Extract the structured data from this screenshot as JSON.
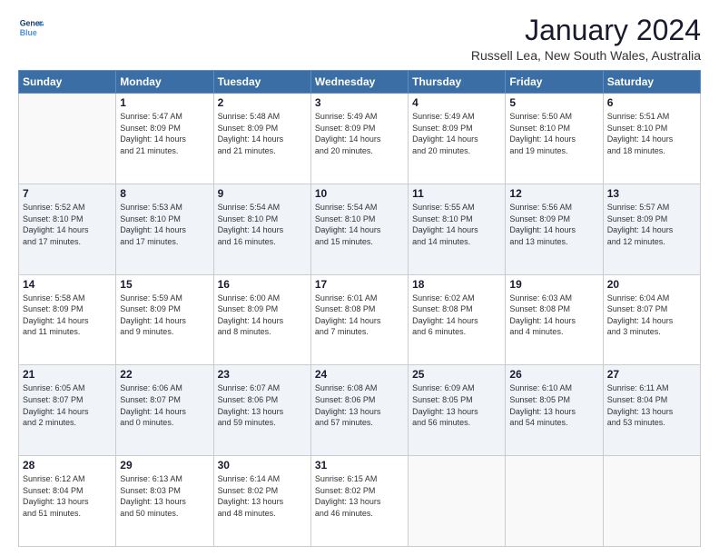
{
  "logo": {
    "line1": "General",
    "line2": "Blue"
  },
  "title": "January 2024",
  "subtitle": "Russell Lea, New South Wales, Australia",
  "weekdays": [
    "Sunday",
    "Monday",
    "Tuesday",
    "Wednesday",
    "Thursday",
    "Friday",
    "Saturday"
  ],
  "weeks": [
    [
      {
        "day": "",
        "info": ""
      },
      {
        "day": "1",
        "info": "Sunrise: 5:47 AM\nSunset: 8:09 PM\nDaylight: 14 hours\nand 21 minutes."
      },
      {
        "day": "2",
        "info": "Sunrise: 5:48 AM\nSunset: 8:09 PM\nDaylight: 14 hours\nand 21 minutes."
      },
      {
        "day": "3",
        "info": "Sunrise: 5:49 AM\nSunset: 8:09 PM\nDaylight: 14 hours\nand 20 minutes."
      },
      {
        "day": "4",
        "info": "Sunrise: 5:49 AM\nSunset: 8:09 PM\nDaylight: 14 hours\nand 20 minutes."
      },
      {
        "day": "5",
        "info": "Sunrise: 5:50 AM\nSunset: 8:10 PM\nDaylight: 14 hours\nand 19 minutes."
      },
      {
        "day": "6",
        "info": "Sunrise: 5:51 AM\nSunset: 8:10 PM\nDaylight: 14 hours\nand 18 minutes."
      }
    ],
    [
      {
        "day": "7",
        "info": "Sunrise: 5:52 AM\nSunset: 8:10 PM\nDaylight: 14 hours\nand 17 minutes."
      },
      {
        "day": "8",
        "info": "Sunrise: 5:53 AM\nSunset: 8:10 PM\nDaylight: 14 hours\nand 17 minutes."
      },
      {
        "day": "9",
        "info": "Sunrise: 5:54 AM\nSunset: 8:10 PM\nDaylight: 14 hours\nand 16 minutes."
      },
      {
        "day": "10",
        "info": "Sunrise: 5:54 AM\nSunset: 8:10 PM\nDaylight: 14 hours\nand 15 minutes."
      },
      {
        "day": "11",
        "info": "Sunrise: 5:55 AM\nSunset: 8:10 PM\nDaylight: 14 hours\nand 14 minutes."
      },
      {
        "day": "12",
        "info": "Sunrise: 5:56 AM\nSunset: 8:09 PM\nDaylight: 14 hours\nand 13 minutes."
      },
      {
        "day": "13",
        "info": "Sunrise: 5:57 AM\nSunset: 8:09 PM\nDaylight: 14 hours\nand 12 minutes."
      }
    ],
    [
      {
        "day": "14",
        "info": "Sunrise: 5:58 AM\nSunset: 8:09 PM\nDaylight: 14 hours\nand 11 minutes."
      },
      {
        "day": "15",
        "info": "Sunrise: 5:59 AM\nSunset: 8:09 PM\nDaylight: 14 hours\nand 9 minutes."
      },
      {
        "day": "16",
        "info": "Sunrise: 6:00 AM\nSunset: 8:09 PM\nDaylight: 14 hours\nand 8 minutes."
      },
      {
        "day": "17",
        "info": "Sunrise: 6:01 AM\nSunset: 8:08 PM\nDaylight: 14 hours\nand 7 minutes."
      },
      {
        "day": "18",
        "info": "Sunrise: 6:02 AM\nSunset: 8:08 PM\nDaylight: 14 hours\nand 6 minutes."
      },
      {
        "day": "19",
        "info": "Sunrise: 6:03 AM\nSunset: 8:08 PM\nDaylight: 14 hours\nand 4 minutes."
      },
      {
        "day": "20",
        "info": "Sunrise: 6:04 AM\nSunset: 8:07 PM\nDaylight: 14 hours\nand 3 minutes."
      }
    ],
    [
      {
        "day": "21",
        "info": "Sunrise: 6:05 AM\nSunset: 8:07 PM\nDaylight: 14 hours\nand 2 minutes."
      },
      {
        "day": "22",
        "info": "Sunrise: 6:06 AM\nSunset: 8:07 PM\nDaylight: 14 hours\nand 0 minutes."
      },
      {
        "day": "23",
        "info": "Sunrise: 6:07 AM\nSunset: 8:06 PM\nDaylight: 13 hours\nand 59 minutes."
      },
      {
        "day": "24",
        "info": "Sunrise: 6:08 AM\nSunset: 8:06 PM\nDaylight: 13 hours\nand 57 minutes."
      },
      {
        "day": "25",
        "info": "Sunrise: 6:09 AM\nSunset: 8:05 PM\nDaylight: 13 hours\nand 56 minutes."
      },
      {
        "day": "26",
        "info": "Sunrise: 6:10 AM\nSunset: 8:05 PM\nDaylight: 13 hours\nand 54 minutes."
      },
      {
        "day": "27",
        "info": "Sunrise: 6:11 AM\nSunset: 8:04 PM\nDaylight: 13 hours\nand 53 minutes."
      }
    ],
    [
      {
        "day": "28",
        "info": "Sunrise: 6:12 AM\nSunset: 8:04 PM\nDaylight: 13 hours\nand 51 minutes."
      },
      {
        "day": "29",
        "info": "Sunrise: 6:13 AM\nSunset: 8:03 PM\nDaylight: 13 hours\nand 50 minutes."
      },
      {
        "day": "30",
        "info": "Sunrise: 6:14 AM\nSunset: 8:02 PM\nDaylight: 13 hours\nand 48 minutes."
      },
      {
        "day": "31",
        "info": "Sunrise: 6:15 AM\nSunset: 8:02 PM\nDaylight: 13 hours\nand 46 minutes."
      },
      {
        "day": "",
        "info": ""
      },
      {
        "day": "",
        "info": ""
      },
      {
        "day": "",
        "info": ""
      }
    ]
  ]
}
